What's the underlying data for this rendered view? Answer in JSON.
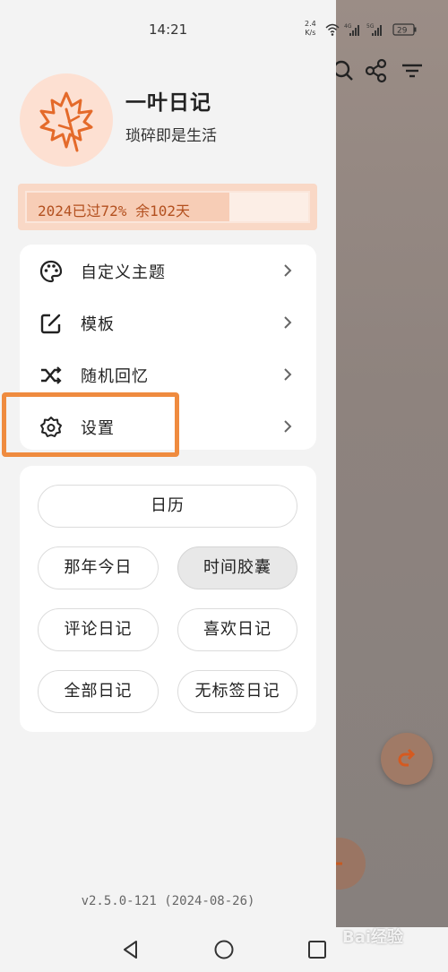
{
  "status_bar": {
    "time": "14:21",
    "net_speed_value": "2.4",
    "net_speed_unit": "K/s",
    "signal_1_label": "4G",
    "signal_2_label": "5G",
    "battery": "29"
  },
  "profile": {
    "app_name": "一叶日记",
    "slogan": "琐碎即是生活",
    "avatar_icon": "maple-leaf-icon"
  },
  "year_progress": {
    "text": "2024已过72% 余102天",
    "percent": 72
  },
  "menu": {
    "items": [
      {
        "label": "自定义主题",
        "icon": "palette-icon"
      },
      {
        "label": "模板",
        "icon": "edit-square-icon"
      },
      {
        "label": "随机回忆",
        "icon": "shuffle-icon"
      },
      {
        "label": "设置",
        "icon": "gear-icon"
      }
    ]
  },
  "buttons": {
    "calendar": "日历",
    "on_this_day": "那年今日",
    "time_capsule": "时间胶囊",
    "commented": "评论日记",
    "liked": "喜欢日记",
    "all": "全部日记",
    "untagged": "无标签日记"
  },
  "version": "v2.5.0-121 (2024-08-26)",
  "watermark": "Bai经验",
  "colors": {
    "accent": "#ef8b3f",
    "avatar_bg": "#fde0d2",
    "progress_text": "#b3501f"
  }
}
